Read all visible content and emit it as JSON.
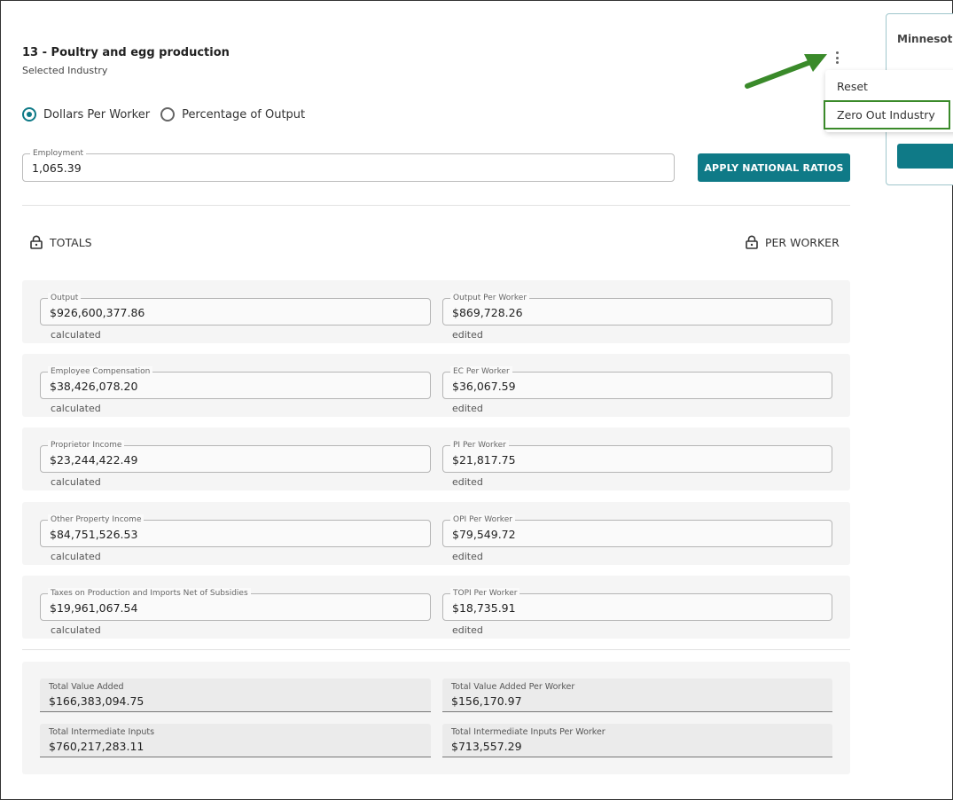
{
  "header": {
    "title": "13 - Poultry and egg production",
    "subtitle": "Selected Industry"
  },
  "mode": {
    "options": [
      {
        "label": "Dollars Per Worker",
        "selected": true
      },
      {
        "label": "Percentage of Output",
        "selected": false
      }
    ]
  },
  "employment": {
    "label": "Employment",
    "value": "1,065.39"
  },
  "apply_button": "APPLY NATIONAL RATIOS",
  "totals_label": "TOTALS",
  "per_worker_label": "PER WORKER",
  "rows": [
    {
      "total_label": "Output",
      "total_value": "$926,600,377.86",
      "total_status": "calculated",
      "pw_label": "Output Per Worker",
      "pw_value": "$869,728.26",
      "pw_status": "edited"
    },
    {
      "total_label": "Employee Compensation",
      "total_value": "$38,426,078.20",
      "total_status": "calculated",
      "pw_label": "EC Per Worker",
      "pw_value": "$36,067.59",
      "pw_status": "edited"
    },
    {
      "total_label": "Proprietor Income",
      "total_value": "$23,244,422.49",
      "total_status": "calculated",
      "pw_label": "PI Per Worker",
      "pw_value": "$21,817.75",
      "pw_status": "edited"
    },
    {
      "total_label": "Other Property Income",
      "total_value": "$84,751,526.53",
      "total_status": "calculated",
      "pw_label": "OPI Per Worker",
      "pw_value": "$79,549.72",
      "pw_status": "edited"
    },
    {
      "total_label": "Taxes on Production and Imports Net of Subsidies",
      "total_value": "$19,961,067.54",
      "total_status": "calculated",
      "pw_label": "TOPI Per Worker",
      "pw_value": "$18,735.91",
      "pw_status": "edited"
    }
  ],
  "summary": {
    "tva_label": "Total Value Added",
    "tva_value": "$166,383,094.75",
    "tva_pw_label": "Total Value Added Per Worker",
    "tva_pw_value": "$156,170.97",
    "tii_label": "Total Intermediate Inputs",
    "tii_value": "$760,217,283.11",
    "tii_pw_label": "Total Intermediate Inputs Per Worker",
    "tii_pw_value": "$713,557.29"
  },
  "side_card": {
    "state_label": "Minnesot"
  },
  "menu": {
    "reset": "Reset",
    "zero_out": "Zero Out Industry"
  },
  "colors": {
    "accent": "#0f7a87",
    "highlight": "#3a8a2a"
  }
}
